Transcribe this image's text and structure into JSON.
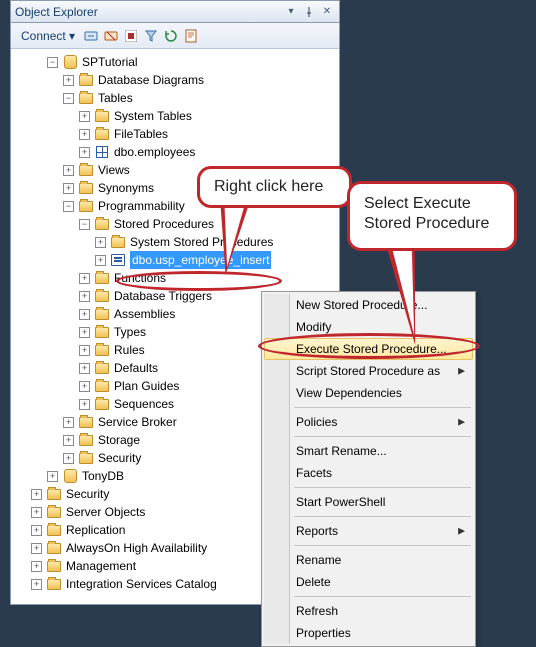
{
  "panel": {
    "title": "Object Explorer"
  },
  "toolbar": {
    "connect_label": "Connect",
    "icons": [
      "object-explorer-connect",
      "object-explorer-disconnect",
      "stop",
      "filter",
      "refresh",
      "script"
    ]
  },
  "tree": {
    "db1": "SPTutorial",
    "n_diagrams": "Database Diagrams",
    "n_tables": "Tables",
    "n_systables": "System Tables",
    "n_filetables": "FileTables",
    "n_dbotable": "dbo.employees",
    "n_views": "Views",
    "n_synonyms": "Synonyms",
    "n_prog": "Programmability",
    "n_sp": "Stored Procedures",
    "n_syssp": "System Stored Procedures",
    "n_usp": "dbo.usp_employee_insert",
    "n_functions": "Functions",
    "n_dbtrig": "Database Triggers",
    "n_asm": "Assemblies",
    "n_types": "Types",
    "n_rules": "Rules",
    "n_defaults": "Defaults",
    "n_plans": "Plan Guides",
    "n_seq": "Sequences",
    "n_sbroker": "Service Broker",
    "n_storage": "Storage",
    "n_security": "Security",
    "db2": "TonyDB",
    "root_security": "Security",
    "root_srvobj": "Server Objects",
    "root_repl": "Replication",
    "root_ha": "AlwaysOn High Availability",
    "root_mgmt": "Management",
    "root_isc": "Integration Services Catalog"
  },
  "ctx": {
    "items": [
      "New Stored Procedure...",
      "Modify",
      "Execute Stored Procedure...",
      "Script Stored Procedure as",
      "View Dependencies",
      "Policies",
      "Facets",
      "Start PowerShell",
      "Reports",
      "Rename",
      "Delete",
      "Refresh",
      "Properties"
    ],
    "submenus": [
      false,
      false,
      false,
      true,
      false,
      true,
      false,
      false,
      true,
      false,
      false,
      false,
      false
    ],
    "hl_index": 2,
    "smart_rename": "Smart Rename..."
  },
  "callouts": {
    "c1": "Right click here",
    "c2": "Select Execute Stored Procedure"
  }
}
